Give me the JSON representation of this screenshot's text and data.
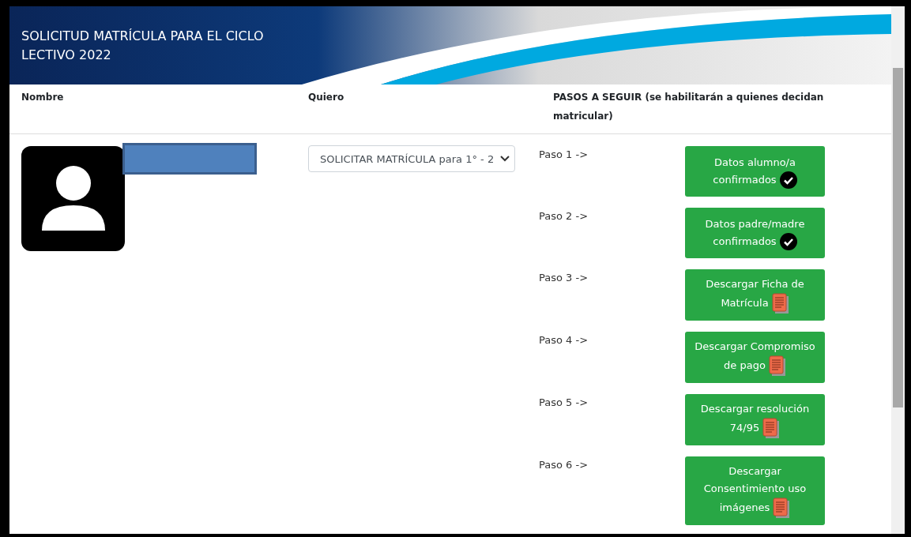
{
  "header": {
    "title": "SOLICITUD MATRÍCULA PARA EL CICLO LECTIVO 2022"
  },
  "table": {
    "columns": [
      "Nombre",
      "Quiero",
      "PASOS A SEGUIR (se habilitarán a quienes decidan matricular)"
    ],
    "row": {
      "choice": {
        "value": "SOLICITAR MATRÍCULA para 1° - 2"
      },
      "steps": [
        {
          "label": "Paso 1 ->",
          "button": "Datos alumno/a confirmados",
          "kind": "check"
        },
        {
          "label": "Paso 2 ->",
          "button": "Datos padre/madre confirmados",
          "kind": "check"
        },
        {
          "label": "Paso 3 ->",
          "button": "Descargar Ficha de Matrícula",
          "kind": "document"
        },
        {
          "label": "Paso 4 ->",
          "button": "Descargar Compromiso de pago",
          "kind": "document"
        },
        {
          "label": "Paso 5 ->",
          "button": "Descargar resolución 74/95",
          "kind": "document"
        },
        {
          "label": "Paso 6 ->",
          "button": "Descargar Consentimiento uso imágenes",
          "kind": "document"
        }
      ]
    }
  }
}
